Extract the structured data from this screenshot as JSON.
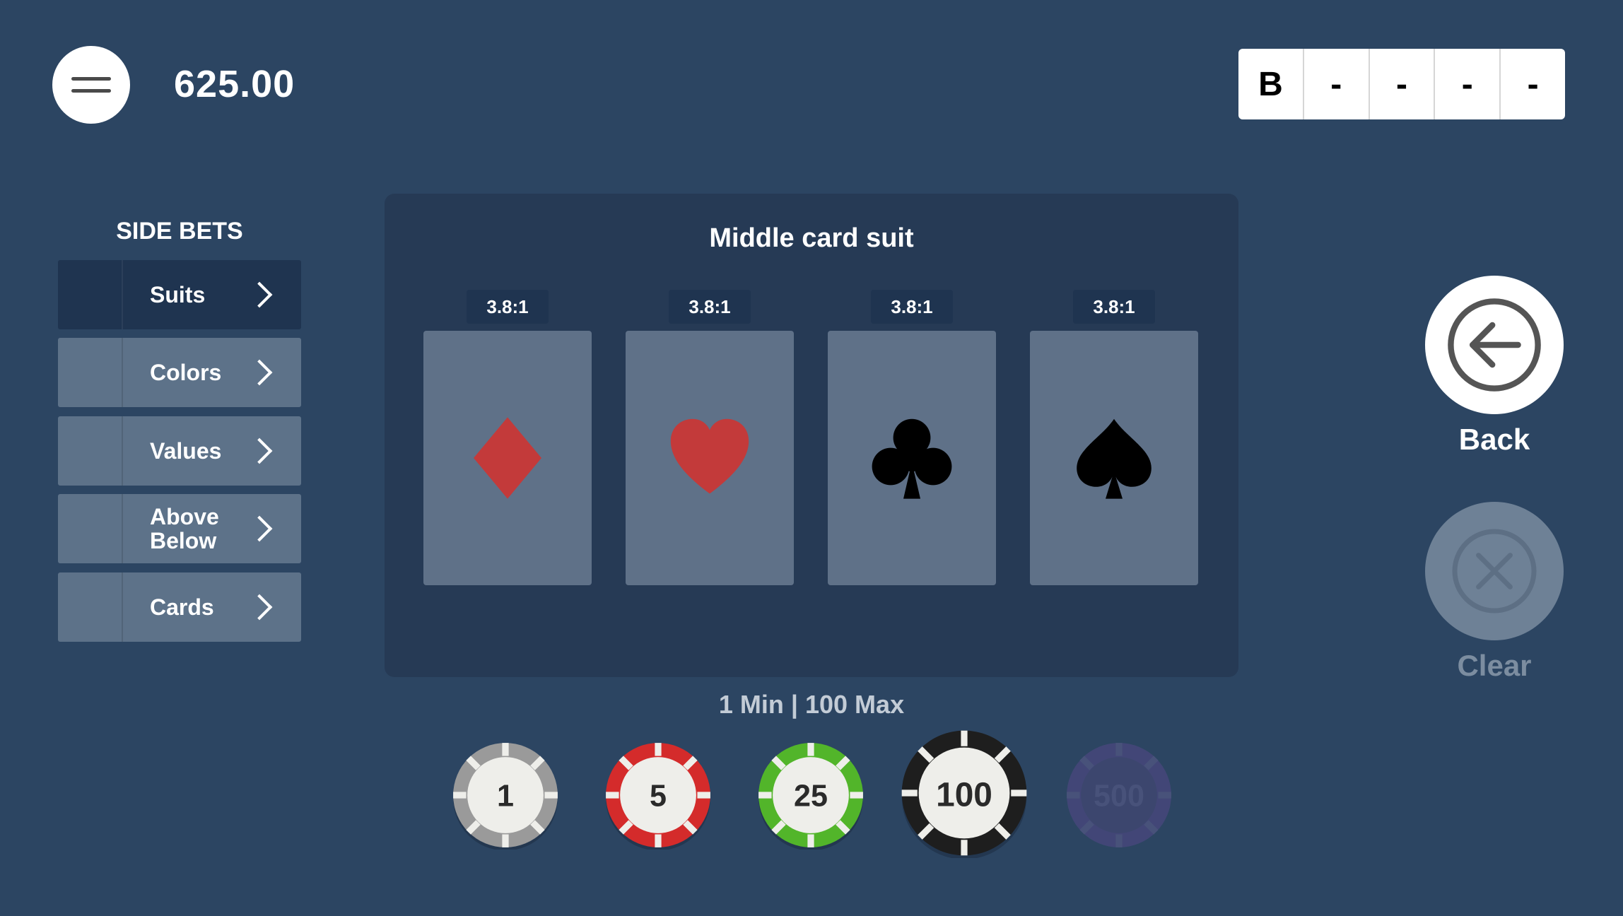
{
  "header": {
    "balance": "625.00",
    "history": [
      "B",
      "-",
      "-",
      "-",
      "-"
    ]
  },
  "side_bets": {
    "title": "SIDE BETS",
    "items": [
      {
        "label": "Suits",
        "active": true
      },
      {
        "label": "Colors",
        "active": false
      },
      {
        "label": "Values",
        "active": false
      },
      {
        "label": "Above Below",
        "active": false
      },
      {
        "label": "Cards",
        "active": false
      }
    ]
  },
  "bet_panel": {
    "title": "Middle card suit",
    "options": [
      {
        "odds": "3.8:1",
        "suit": "diamond-icon",
        "color": "#c33a3a"
      },
      {
        "odds": "3.8:1",
        "suit": "heart-icon",
        "color": "#c33a3a"
      },
      {
        "odds": "3.8:1",
        "suit": "club-icon",
        "color": "#000000"
      },
      {
        "odds": "3.8:1",
        "suit": "spade-icon",
        "color": "#000000"
      }
    ],
    "limits": "1 Min | 100 Max"
  },
  "chips": [
    {
      "value": "1",
      "color": "#9a9a9a",
      "enabled": true
    },
    {
      "value": "5",
      "color": "#d42b2b",
      "enabled": true
    },
    {
      "value": "25",
      "color": "#52b52a",
      "enabled": true
    },
    {
      "value": "100",
      "color": "#1e1e1e",
      "enabled": true,
      "selected": true
    },
    {
      "value": "500",
      "color": "#6b4a9e",
      "enabled": false
    }
  ],
  "controls": {
    "back_label": "Back",
    "clear_label": "Clear"
  }
}
